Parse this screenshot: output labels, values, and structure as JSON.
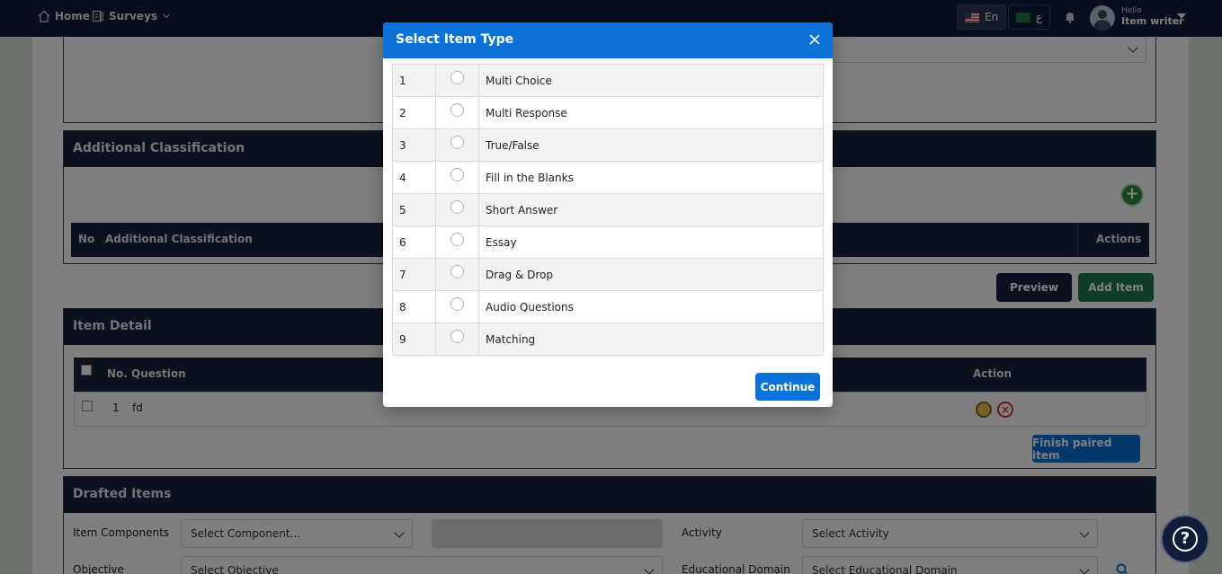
{
  "topbar": {
    "home": "Home",
    "surveys": "Surveys",
    "lang_en": "En",
    "lang_ar": "ع",
    "greeting": "Hello",
    "user_name": "Item writer"
  },
  "additional_classification": {
    "title": "Additional Classification",
    "col_no": "No",
    "col_name": "Additional Classification",
    "col_actions": "Actions"
  },
  "actions": {
    "preview": "Preview",
    "add_item": "Add Item",
    "finish_paired": "Finish paired item"
  },
  "item_detail": {
    "title": "Item Detail",
    "col_no": "No.",
    "col_question": "Question",
    "col_action": "Action",
    "rows": [
      {
        "no": "1",
        "question": "fd"
      }
    ]
  },
  "drafted_items": {
    "title": "Drafted Items",
    "item_components_label": "Item Components",
    "item_components_value": "Select Component...",
    "activity_label": "Activity",
    "activity_value": "Select Activity",
    "objective_label": "Objective",
    "objective_value": "Select Objective",
    "edu_domain_label": "Educational Domain",
    "edu_domain_value": "Select Educational Domain"
  },
  "modal": {
    "title": "Select Item Type",
    "continue": "Continue",
    "items": [
      {
        "no": "1",
        "label": "Multi Choice"
      },
      {
        "no": "2",
        "label": "Multi Response"
      },
      {
        "no": "3",
        "label": "True/False"
      },
      {
        "no": "4",
        "label": "Fill in the Blanks"
      },
      {
        "no": "5",
        "label": "Short Answer"
      },
      {
        "no": "6",
        "label": "Essay"
      },
      {
        "no": "7",
        "label": "Drag & Drop"
      },
      {
        "no": "8",
        "label": "Audio Questions"
      },
      {
        "no": "9",
        "label": "Matching"
      }
    ]
  },
  "help": {
    "symbol": "?"
  },
  "colors": {
    "navy": "#16233f",
    "modal_blue": "#0b72d9",
    "green": "#1f7a4a"
  }
}
